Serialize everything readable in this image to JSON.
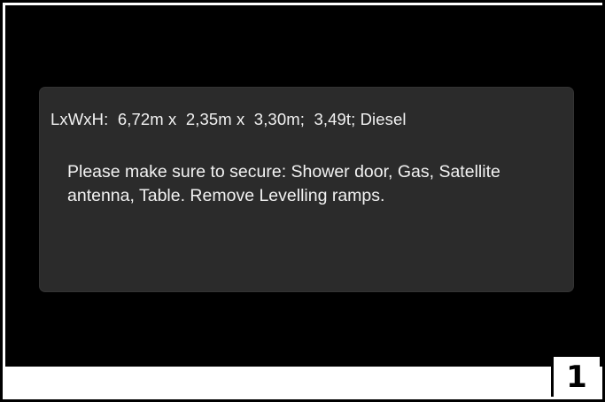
{
  "card": {
    "specs": "LxWxH:  6,72m x  2,35m x  3,30m;  3,49t; Diesel",
    "message": "Please make sure to secure: Shower door, Gas, Satellite antenna, Table. Remove Levelling ramps."
  },
  "figure_number": "1",
  "colors": {
    "screen_background": "#000000",
    "card_background": "#2b2b2b",
    "text": "#f2f2f2"
  }
}
